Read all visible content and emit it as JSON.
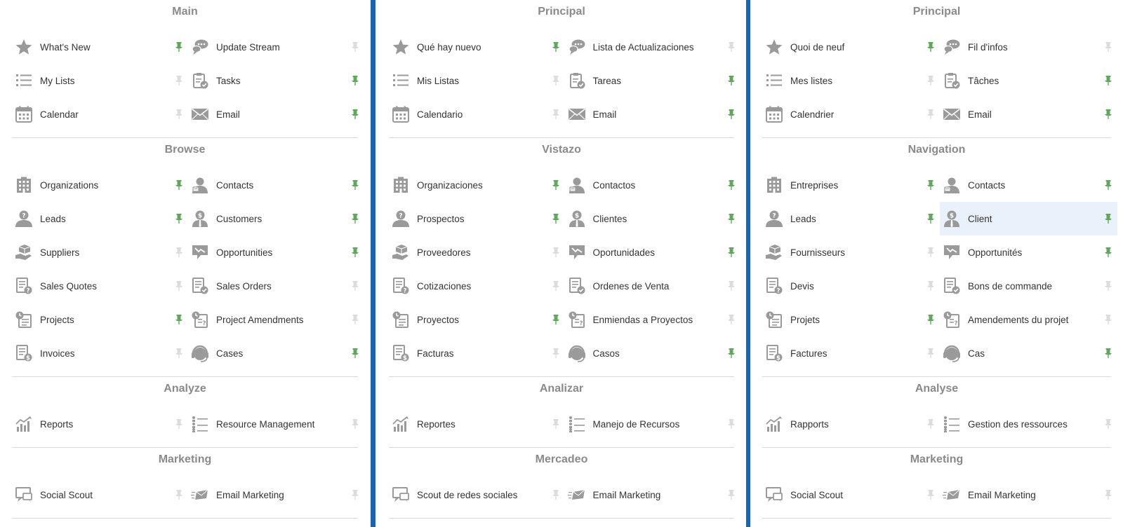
{
  "colors": {
    "separator": "#1565b8",
    "pin_on": "#5fa85a",
    "pin_off": "#dcdcdc",
    "icon": "#9a9a9a",
    "highlight": "#e9f2fb"
  },
  "panels": [
    {
      "sections": [
        {
          "title": "Main",
          "items": [
            {
              "label": "What's New",
              "icon": "star-icon",
              "pinned": true
            },
            {
              "label": "Update Stream",
              "icon": "chat-bubbles-icon",
              "pinned": false
            },
            {
              "label": "My Lists",
              "icon": "list-icon",
              "pinned": false
            },
            {
              "label": "Tasks",
              "icon": "clipboard-check-icon",
              "pinned": true
            },
            {
              "label": "Calendar",
              "icon": "calendar-icon",
              "pinned": false
            },
            {
              "label": "Email",
              "icon": "envelope-icon",
              "pinned": true
            }
          ]
        },
        {
          "title": "Browse",
          "items": [
            {
              "label": "Organizations",
              "icon": "building-icon",
              "pinned": true
            },
            {
              "label": "Contacts",
              "icon": "contact-person-icon",
              "pinned": true
            },
            {
              "label": "Leads",
              "icon": "lead-person-icon",
              "pinned": true
            },
            {
              "label": "Customers",
              "icon": "customer-person-icon",
              "pinned": true
            },
            {
              "label": "Suppliers",
              "icon": "supplier-hand-box-icon",
              "pinned": false
            },
            {
              "label": "Opportunities",
              "icon": "opportunity-icon",
              "pinned": true
            },
            {
              "label": "Sales Quotes",
              "icon": "quote-document-icon",
              "pinned": false
            },
            {
              "label": "Sales Orders",
              "icon": "order-document-icon",
              "pinned": false
            },
            {
              "label": "Projects",
              "icon": "project-icon",
              "pinned": true
            },
            {
              "label": "Project Amendments",
              "icon": "project-amendment-icon",
              "pinned": false
            },
            {
              "label": "Invoices",
              "icon": "invoice-icon",
              "pinned": false
            },
            {
              "label": "Cases",
              "icon": "headset-icon",
              "pinned": true
            }
          ]
        },
        {
          "title": "Analyze",
          "items": [
            {
              "label": "Reports",
              "icon": "bar-chart-icon",
              "pinned": false
            },
            {
              "label": "Resource Management",
              "icon": "resource-list-icon",
              "pinned": false
            }
          ]
        },
        {
          "title": "Marketing",
          "items": [
            {
              "label": "Social Scout",
              "icon": "social-scout-icon",
              "pinned": false
            },
            {
              "label": "Email Marketing",
              "icon": "email-marketing-icon",
              "pinned": false
            }
          ]
        }
      ]
    },
    {
      "sections": [
        {
          "title": "Principal",
          "items": [
            {
              "label": "Qué hay nuevo",
              "icon": "star-icon",
              "pinned": true
            },
            {
              "label": "Lista de Actualizaciones",
              "icon": "chat-bubbles-icon",
              "pinned": false
            },
            {
              "label": "Mis Listas",
              "icon": "list-icon",
              "pinned": false
            },
            {
              "label": "Tareas",
              "icon": "clipboard-check-icon",
              "pinned": true
            },
            {
              "label": "Calendario",
              "icon": "calendar-icon",
              "pinned": false
            },
            {
              "label": "Email",
              "icon": "envelope-icon",
              "pinned": true
            }
          ]
        },
        {
          "title": "Vistazo",
          "items": [
            {
              "label": "Organizaciones",
              "icon": "building-icon",
              "pinned": true
            },
            {
              "label": "Contactos",
              "icon": "contact-person-icon",
              "pinned": true
            },
            {
              "label": "Prospectos",
              "icon": "lead-person-icon",
              "pinned": true
            },
            {
              "label": "Clientes",
              "icon": "customer-person-icon",
              "pinned": true
            },
            {
              "label": "Proveedores",
              "icon": "supplier-hand-box-icon",
              "pinned": false
            },
            {
              "label": "Oportunidades",
              "icon": "opportunity-icon",
              "pinned": true
            },
            {
              "label": "Cotizaciones",
              "icon": "quote-document-icon",
              "pinned": false
            },
            {
              "label": "Ordenes de Venta",
              "icon": "order-document-icon",
              "pinned": false
            },
            {
              "label": "Proyectos",
              "icon": "project-icon",
              "pinned": true
            },
            {
              "label": "Enmiendas a Proyectos",
              "icon": "project-amendment-icon",
              "pinned": false
            },
            {
              "label": "Facturas",
              "icon": "invoice-icon",
              "pinned": false
            },
            {
              "label": "Casos",
              "icon": "headset-icon",
              "pinned": true
            }
          ]
        },
        {
          "title": "Analizar",
          "items": [
            {
              "label": "Reportes",
              "icon": "bar-chart-icon",
              "pinned": false
            },
            {
              "label": "Manejo de Recursos",
              "icon": "resource-list-icon",
              "pinned": false
            }
          ]
        },
        {
          "title": "Mercadeo",
          "items": [
            {
              "label": "Scout de redes sociales",
              "icon": "social-scout-icon",
              "pinned": false
            },
            {
              "label": "Email Marketing",
              "icon": "email-marketing-icon",
              "pinned": false
            }
          ]
        }
      ]
    },
    {
      "sections": [
        {
          "title": "Principal",
          "items": [
            {
              "label": "Quoi de neuf",
              "icon": "star-icon",
              "pinned": true
            },
            {
              "label": "Fil d'infos",
              "icon": "chat-bubbles-icon",
              "pinned": false
            },
            {
              "label": "Mes listes",
              "icon": "list-icon",
              "pinned": false
            },
            {
              "label": "Tâches",
              "icon": "clipboard-check-icon",
              "pinned": true
            },
            {
              "label": "Calendrier",
              "icon": "calendar-icon",
              "pinned": false
            },
            {
              "label": "Email",
              "icon": "envelope-icon",
              "pinned": true
            }
          ]
        },
        {
          "title": "Navigation",
          "items": [
            {
              "label": "Entreprises",
              "icon": "building-icon",
              "pinned": true
            },
            {
              "label": "Contacts",
              "icon": "contact-person-icon",
              "pinned": true
            },
            {
              "label": "Leads",
              "icon": "lead-person-icon",
              "pinned": true
            },
            {
              "label": "Client",
              "icon": "customer-person-icon",
              "pinned": true,
              "highlighted": true
            },
            {
              "label": "Fournisseurs",
              "icon": "supplier-hand-box-icon",
              "pinned": false
            },
            {
              "label": "Opportunités",
              "icon": "opportunity-icon",
              "pinned": true
            },
            {
              "label": "Devis",
              "icon": "quote-document-icon",
              "pinned": false
            },
            {
              "label": "Bons de commande",
              "icon": "order-document-icon",
              "pinned": false
            },
            {
              "label": "Projets",
              "icon": "project-icon",
              "pinned": true
            },
            {
              "label": "Amendements du projet",
              "icon": "project-amendment-icon",
              "pinned": false
            },
            {
              "label": "Factures",
              "icon": "invoice-icon",
              "pinned": false
            },
            {
              "label": "Cas",
              "icon": "headset-icon",
              "pinned": true
            }
          ]
        },
        {
          "title": "Analyse",
          "items": [
            {
              "label": "Rapports",
              "icon": "bar-chart-icon",
              "pinned": false
            },
            {
              "label": "Gestion des ressources",
              "icon": "resource-list-icon",
              "pinned": false
            }
          ]
        },
        {
          "title": "Marketing",
          "items": [
            {
              "label": "Social Scout",
              "icon": "social-scout-icon",
              "pinned": false
            },
            {
              "label": "Email Marketing",
              "icon": "email-marketing-icon",
              "pinned": false
            }
          ]
        }
      ]
    }
  ]
}
